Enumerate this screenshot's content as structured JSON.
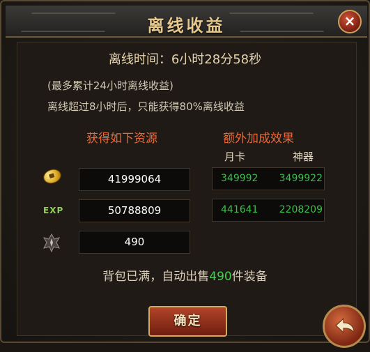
{
  "dialog": {
    "title": "离线收益",
    "close_label": "×"
  },
  "offline": {
    "time_line": "离线时间：6小时28分58秒",
    "note_max": "(最多累计24小时离线收益)",
    "note_rule": "离线超过8小时后，只能获得80%离线收益"
  },
  "rewards": {
    "header": "获得如下资源",
    "rows": [
      {
        "icon": "gold-coin-icon",
        "value": "41999064"
      },
      {
        "icon": "exp-icon",
        "icon_text": "EXP",
        "value": "50788809"
      },
      {
        "icon": "equipment-icon",
        "value": "490"
      }
    ]
  },
  "bonus": {
    "header": "额外加成效果",
    "col1": "月卡",
    "col2": "神器",
    "rows": [
      {
        "month_card": "349992",
        "artifact": "3499922"
      },
      {
        "month_card": "441641",
        "artifact": "2208209"
      }
    ]
  },
  "bag": {
    "prefix": "背包已满，自动出售",
    "count": "490",
    "suffix": "件装备"
  },
  "buttons": {
    "confirm": "确定"
  },
  "colors": {
    "title": "#e8c98c",
    "section_header": "#e8693a",
    "bonus_value": "#39c04a",
    "highlight_count": "#41d04e"
  }
}
